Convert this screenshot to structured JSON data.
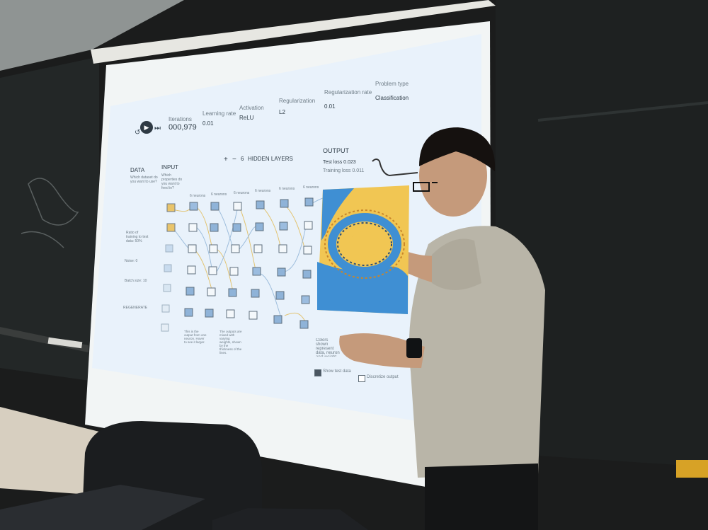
{
  "toolbar": {
    "iterations_label": "Iterations",
    "iterations_value": "000,979",
    "learning_rate_label": "Learning rate",
    "learning_rate_value": "0.01",
    "activation_label": "Activation",
    "activation_value": "ReLU",
    "regularization_label": "Regularization",
    "regularization_value": "L2",
    "regularization_rate_label": "Regularization rate",
    "regularization_rate_value": "0.01",
    "problem_type_label": "Problem type",
    "problem_type_value": "Classification"
  },
  "data_panel": {
    "title": "DATA",
    "prompt": "Which dataset do you want to use?",
    "ratio_label": "Ratio of training to test data: 50%",
    "noise_label": "Noise: 0",
    "batch_label": "Batch size: 10",
    "regenerate_label": "REGENERATE"
  },
  "network": {
    "input_title": "INPUT",
    "input_prompt": "Which properties do you want to feed in?",
    "hidden_layers_count": "6",
    "hidden_layers_label": "HIDDEN LAYERS",
    "add_label": "+",
    "remove_label": "−",
    "layers": [
      {
        "label": "6 neurons"
      },
      {
        "label": "6 neurons"
      },
      {
        "label": "6 neurons"
      },
      {
        "label": "6 neurons"
      },
      {
        "label": "6 neurons"
      },
      {
        "label": "6 neurons"
      }
    ],
    "note_1": "This is the output from one neuron. Hover to see it larger.",
    "note_2": "The outputs are mixed with varying weights, shown by the thickness of the lines."
  },
  "output": {
    "title": "OUTPUT",
    "test_loss": "Test loss 0.023",
    "training_loss": "Training loss 0.011",
    "legend_text": "Colors shown represent data, neuron and weight values.",
    "show_test_label": "Show test data",
    "discretize_label": "Discretize output"
  },
  "colors": {
    "positive": "#f0b429",
    "negative": "#3b8dd1",
    "screen": "#e9f2fb"
  }
}
